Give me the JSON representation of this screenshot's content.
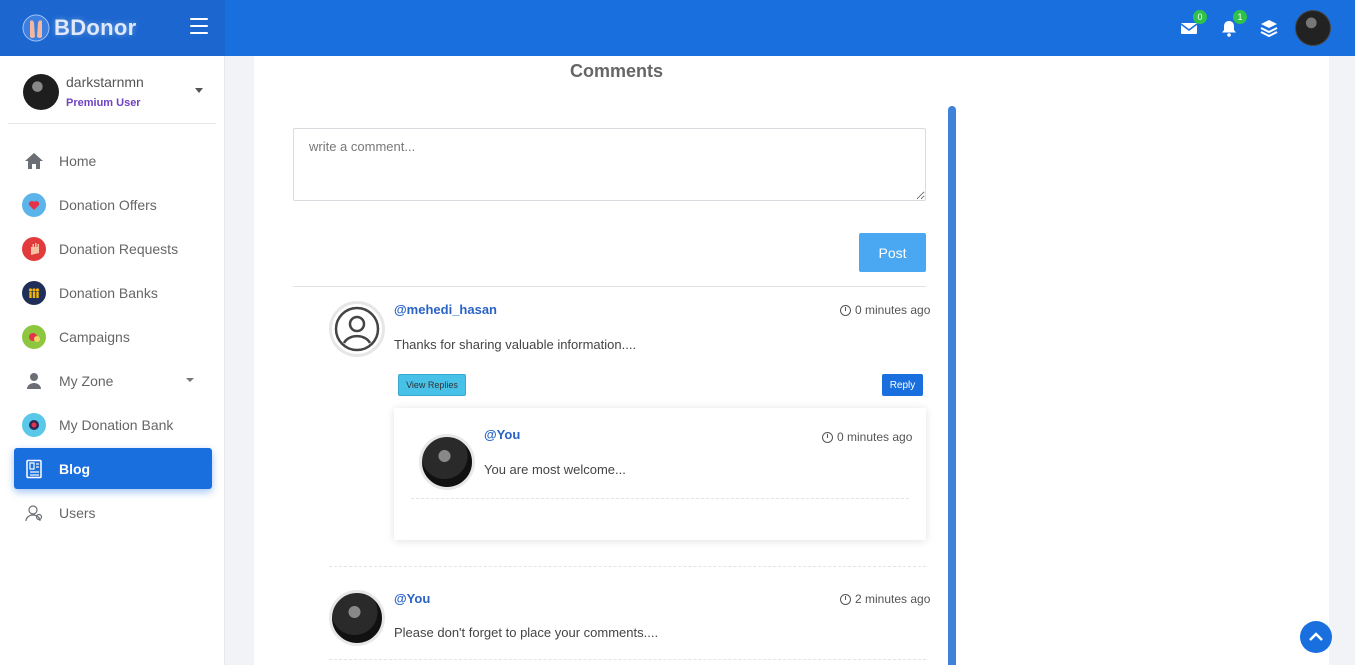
{
  "brand": {
    "name": "BDonor"
  },
  "header": {
    "messages_count": "0",
    "notifications_count": "1"
  },
  "user": {
    "name": "darkstarnmn",
    "role": "Premium User"
  },
  "sidebar": {
    "items": [
      {
        "label": "Home",
        "icon": "home-icon"
      },
      {
        "label": "Donation Offers",
        "icon": "heart-hand-icon"
      },
      {
        "label": "Donation Requests",
        "icon": "raised-hand-icon"
      },
      {
        "label": "Donation Banks",
        "icon": "bank-people-icon"
      },
      {
        "label": "Campaigns",
        "icon": "campaign-icon"
      },
      {
        "label": "My Zone",
        "icon": "person-icon"
      },
      {
        "label": "My Donation Bank",
        "icon": "donation-bank-icon"
      },
      {
        "label": "Blog",
        "icon": "blog-icon",
        "active": true
      },
      {
        "label": "Users",
        "icon": "users-icon"
      }
    ]
  },
  "comments_section": {
    "heading": "Comments",
    "placeholder": "write a comment...",
    "post_label": "Post",
    "comments": [
      {
        "user": "@mehedi_hasan",
        "time": "0 minutes ago",
        "text": "Thanks for sharing valuable information....",
        "view_replies_label": "View Replies",
        "reply_label": "Reply",
        "replies": [
          {
            "user": "@You",
            "time": "0 minutes ago",
            "text": "You are most welcome..."
          }
        ]
      },
      {
        "user": "@You",
        "time": "2 minutes ago",
        "text": "Please don't forget to place your comments...."
      }
    ]
  },
  "colors": {
    "primary": "#1a6fdf",
    "post_button": "#4aa8f2",
    "view_replies": "#48c1e8",
    "badge": "#2ec24a",
    "premium": "#6f42c1"
  }
}
